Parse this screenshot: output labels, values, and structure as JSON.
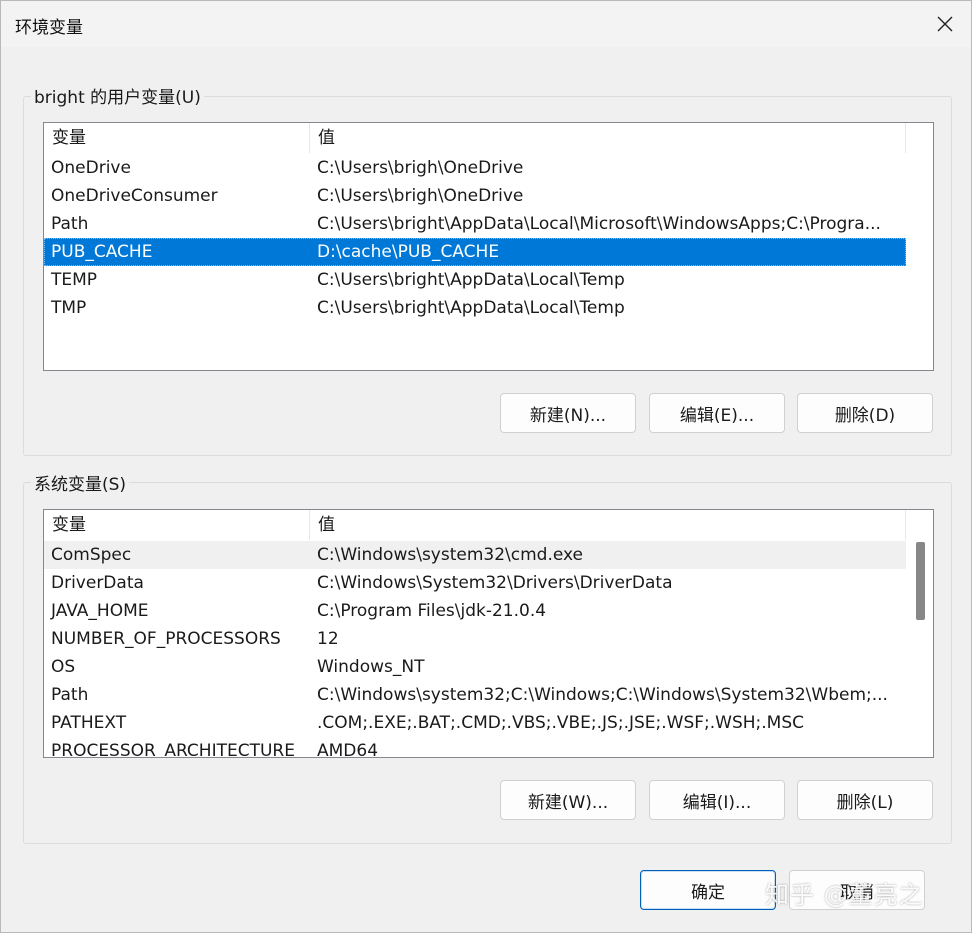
{
  "window": {
    "title": "环境变量"
  },
  "user_vars": {
    "group_label": "bright 的用户变量(U)",
    "columns": [
      "变量",
      "值"
    ],
    "rows": [
      {
        "name": "OneDrive",
        "value": "C:\\Users\\brigh\\OneDrive",
        "selected": false
      },
      {
        "name": "OneDriveConsumer",
        "value": "C:\\Users\\brigh\\OneDrive",
        "selected": false
      },
      {
        "name": "Path",
        "value": "C:\\Users\\bright\\AppData\\Local\\Microsoft\\WindowsApps;C:\\Progra...",
        "selected": false
      },
      {
        "name": "PUB_CACHE",
        "value": "D:\\cache\\PUB_CACHE",
        "selected": true
      },
      {
        "name": "TEMP",
        "value": "C:\\Users\\bright\\AppData\\Local\\Temp",
        "selected": false
      },
      {
        "name": "TMP",
        "value": "C:\\Users\\bright\\AppData\\Local\\Temp",
        "selected": false
      }
    ],
    "buttons": {
      "new": "新建(N)...",
      "edit": "编辑(E)...",
      "delete": "删除(D)"
    }
  },
  "sys_vars": {
    "group_label": "系统变量(S)",
    "columns": [
      "变量",
      "值"
    ],
    "rows": [
      {
        "name": "ComSpec",
        "value": "C:\\Windows\\system32\\cmd.exe",
        "hover": true
      },
      {
        "name": "DriverData",
        "value": "C:\\Windows\\System32\\Drivers\\DriverData"
      },
      {
        "name": "JAVA_HOME",
        "value": "C:\\Program Files\\jdk-21.0.4"
      },
      {
        "name": "NUMBER_OF_PROCESSORS",
        "value": "12"
      },
      {
        "name": "OS",
        "value": "Windows_NT"
      },
      {
        "name": "Path",
        "value": "C:\\Windows\\system32;C:\\Windows;C:\\Windows\\System32\\Wbem;..."
      },
      {
        "name": "PATHEXT",
        "value": ".COM;.EXE;.BAT;.CMD;.VBS;.VBE;.JS;.JSE;.WSF;.WSH;.MSC"
      },
      {
        "name": "PROCESSOR_ARCHITECTURE",
        "value": "AMD64"
      }
    ],
    "buttons": {
      "new": "新建(W)...",
      "edit": "编辑(I)...",
      "delete": "删除(L)"
    }
  },
  "footer": {
    "ok": "确定",
    "cancel": "取消"
  },
  "watermark": "知乎 @董亮之",
  "colors": {
    "selection": "#0078d7",
    "primary_border": "#005fb8"
  }
}
